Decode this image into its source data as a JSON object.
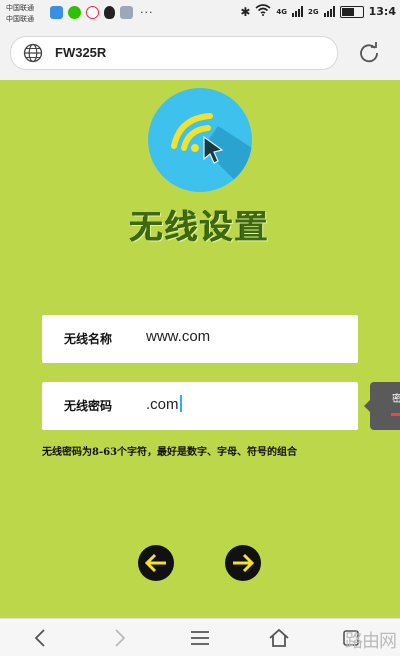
{
  "status_bar": {
    "carrier_1": "中国联通",
    "carrier_2": "中国联通",
    "more": "···",
    "net_1": "4G",
    "net_2": "2G",
    "time": "13:4"
  },
  "browser": {
    "url": "FW325R"
  },
  "page": {
    "title": "无线设置",
    "ssid_label": "无线名称",
    "ssid_value": "www.com",
    "password_label": "无线密码",
    "password_value": ".com",
    "tooltip_char": "密",
    "hint": "无线密码为8-63个字符，最好是数字、字母、符号的组合"
  },
  "bottom_bar": {
    "watermark": "路由网"
  },
  "colors": {
    "background": "#bcd84a",
    "logo_circle": "#3ec1ec",
    "title": "#3d6a10",
    "cursor": "#2ab1e6"
  }
}
